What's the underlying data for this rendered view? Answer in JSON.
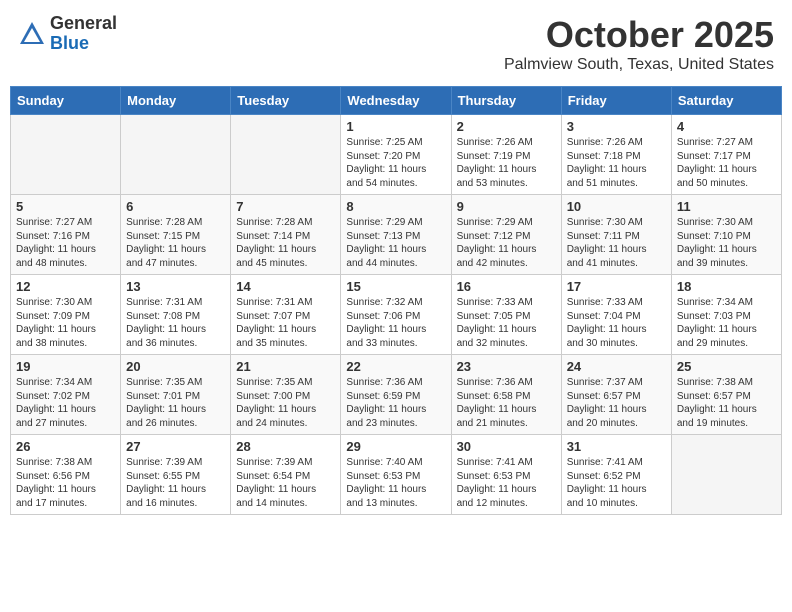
{
  "header": {
    "logo_general": "General",
    "logo_blue": "Blue",
    "month_title": "October 2025",
    "location": "Palmview South, Texas, United States"
  },
  "weekdays": [
    "Sunday",
    "Monday",
    "Tuesday",
    "Wednesday",
    "Thursday",
    "Friday",
    "Saturday"
  ],
  "weeks": [
    [
      {
        "day": "",
        "sunrise": "",
        "sunset": "",
        "daylight": ""
      },
      {
        "day": "",
        "sunrise": "",
        "sunset": "",
        "daylight": ""
      },
      {
        "day": "",
        "sunrise": "",
        "sunset": "",
        "daylight": ""
      },
      {
        "day": "1",
        "sunrise": "Sunrise: 7:25 AM",
        "sunset": "Sunset: 7:20 PM",
        "daylight": "Daylight: 11 hours and 54 minutes."
      },
      {
        "day": "2",
        "sunrise": "Sunrise: 7:26 AM",
        "sunset": "Sunset: 7:19 PM",
        "daylight": "Daylight: 11 hours and 53 minutes."
      },
      {
        "day": "3",
        "sunrise": "Sunrise: 7:26 AM",
        "sunset": "Sunset: 7:18 PM",
        "daylight": "Daylight: 11 hours and 51 minutes."
      },
      {
        "day": "4",
        "sunrise": "Sunrise: 7:27 AM",
        "sunset": "Sunset: 7:17 PM",
        "daylight": "Daylight: 11 hours and 50 minutes."
      }
    ],
    [
      {
        "day": "5",
        "sunrise": "Sunrise: 7:27 AM",
        "sunset": "Sunset: 7:16 PM",
        "daylight": "Daylight: 11 hours and 48 minutes."
      },
      {
        "day": "6",
        "sunrise": "Sunrise: 7:28 AM",
        "sunset": "Sunset: 7:15 PM",
        "daylight": "Daylight: 11 hours and 47 minutes."
      },
      {
        "day": "7",
        "sunrise": "Sunrise: 7:28 AM",
        "sunset": "Sunset: 7:14 PM",
        "daylight": "Daylight: 11 hours and 45 minutes."
      },
      {
        "day": "8",
        "sunrise": "Sunrise: 7:29 AM",
        "sunset": "Sunset: 7:13 PM",
        "daylight": "Daylight: 11 hours and 44 minutes."
      },
      {
        "day": "9",
        "sunrise": "Sunrise: 7:29 AM",
        "sunset": "Sunset: 7:12 PM",
        "daylight": "Daylight: 11 hours and 42 minutes."
      },
      {
        "day": "10",
        "sunrise": "Sunrise: 7:30 AM",
        "sunset": "Sunset: 7:11 PM",
        "daylight": "Daylight: 11 hours and 41 minutes."
      },
      {
        "day": "11",
        "sunrise": "Sunrise: 7:30 AM",
        "sunset": "Sunset: 7:10 PM",
        "daylight": "Daylight: 11 hours and 39 minutes."
      }
    ],
    [
      {
        "day": "12",
        "sunrise": "Sunrise: 7:30 AM",
        "sunset": "Sunset: 7:09 PM",
        "daylight": "Daylight: 11 hours and 38 minutes."
      },
      {
        "day": "13",
        "sunrise": "Sunrise: 7:31 AM",
        "sunset": "Sunset: 7:08 PM",
        "daylight": "Daylight: 11 hours and 36 minutes."
      },
      {
        "day": "14",
        "sunrise": "Sunrise: 7:31 AM",
        "sunset": "Sunset: 7:07 PM",
        "daylight": "Daylight: 11 hours and 35 minutes."
      },
      {
        "day": "15",
        "sunrise": "Sunrise: 7:32 AM",
        "sunset": "Sunset: 7:06 PM",
        "daylight": "Daylight: 11 hours and 33 minutes."
      },
      {
        "day": "16",
        "sunrise": "Sunrise: 7:33 AM",
        "sunset": "Sunset: 7:05 PM",
        "daylight": "Daylight: 11 hours and 32 minutes."
      },
      {
        "day": "17",
        "sunrise": "Sunrise: 7:33 AM",
        "sunset": "Sunset: 7:04 PM",
        "daylight": "Daylight: 11 hours and 30 minutes."
      },
      {
        "day": "18",
        "sunrise": "Sunrise: 7:34 AM",
        "sunset": "Sunset: 7:03 PM",
        "daylight": "Daylight: 11 hours and 29 minutes."
      }
    ],
    [
      {
        "day": "19",
        "sunrise": "Sunrise: 7:34 AM",
        "sunset": "Sunset: 7:02 PM",
        "daylight": "Daylight: 11 hours and 27 minutes."
      },
      {
        "day": "20",
        "sunrise": "Sunrise: 7:35 AM",
        "sunset": "Sunset: 7:01 PM",
        "daylight": "Daylight: 11 hours and 26 minutes."
      },
      {
        "day": "21",
        "sunrise": "Sunrise: 7:35 AM",
        "sunset": "Sunset: 7:00 PM",
        "daylight": "Daylight: 11 hours and 24 minutes."
      },
      {
        "day": "22",
        "sunrise": "Sunrise: 7:36 AM",
        "sunset": "Sunset: 6:59 PM",
        "daylight": "Daylight: 11 hours and 23 minutes."
      },
      {
        "day": "23",
        "sunrise": "Sunrise: 7:36 AM",
        "sunset": "Sunset: 6:58 PM",
        "daylight": "Daylight: 11 hours and 21 minutes."
      },
      {
        "day": "24",
        "sunrise": "Sunrise: 7:37 AM",
        "sunset": "Sunset: 6:57 PM",
        "daylight": "Daylight: 11 hours and 20 minutes."
      },
      {
        "day": "25",
        "sunrise": "Sunrise: 7:38 AM",
        "sunset": "Sunset: 6:57 PM",
        "daylight": "Daylight: 11 hours and 19 minutes."
      }
    ],
    [
      {
        "day": "26",
        "sunrise": "Sunrise: 7:38 AM",
        "sunset": "Sunset: 6:56 PM",
        "daylight": "Daylight: 11 hours and 17 minutes."
      },
      {
        "day": "27",
        "sunrise": "Sunrise: 7:39 AM",
        "sunset": "Sunset: 6:55 PM",
        "daylight": "Daylight: 11 hours and 16 minutes."
      },
      {
        "day": "28",
        "sunrise": "Sunrise: 7:39 AM",
        "sunset": "Sunset: 6:54 PM",
        "daylight": "Daylight: 11 hours and 14 minutes."
      },
      {
        "day": "29",
        "sunrise": "Sunrise: 7:40 AM",
        "sunset": "Sunset: 6:53 PM",
        "daylight": "Daylight: 11 hours and 13 minutes."
      },
      {
        "day": "30",
        "sunrise": "Sunrise: 7:41 AM",
        "sunset": "Sunset: 6:53 PM",
        "daylight": "Daylight: 11 hours and 12 minutes."
      },
      {
        "day": "31",
        "sunrise": "Sunrise: 7:41 AM",
        "sunset": "Sunset: 6:52 PM",
        "daylight": "Daylight: 11 hours and 10 minutes."
      },
      {
        "day": "",
        "sunrise": "",
        "sunset": "",
        "daylight": ""
      }
    ]
  ]
}
